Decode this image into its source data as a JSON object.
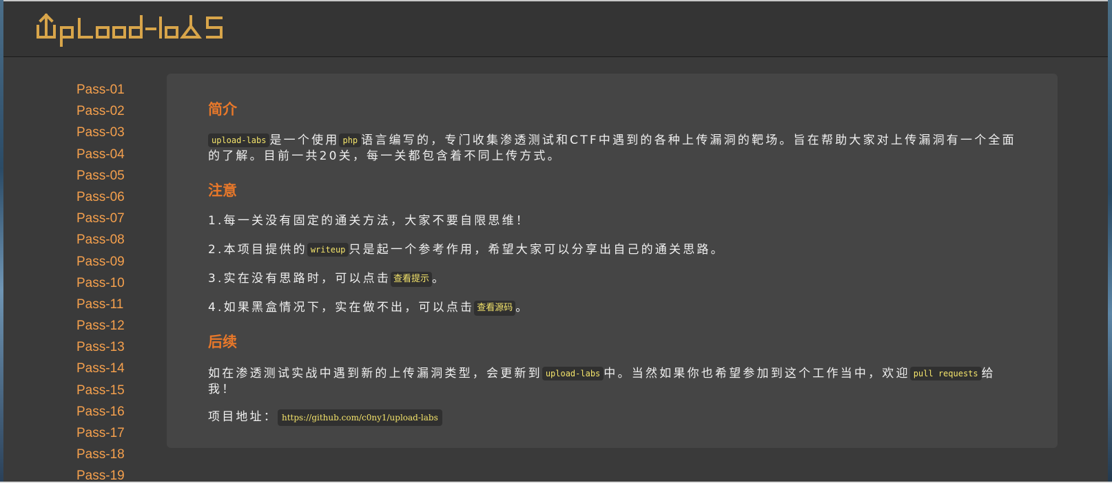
{
  "app": {
    "logo_text": "UpLoad-labs"
  },
  "sidebar": {
    "items": [
      {
        "label": "Pass-01"
      },
      {
        "label": "Pass-02"
      },
      {
        "label": "Pass-03"
      },
      {
        "label": "Pass-04"
      },
      {
        "label": "Pass-05"
      },
      {
        "label": "Pass-06"
      },
      {
        "label": "Pass-07"
      },
      {
        "label": "Pass-08"
      },
      {
        "label": "Pass-09"
      },
      {
        "label": "Pass-10"
      },
      {
        "label": "Pass-11"
      },
      {
        "label": "Pass-12"
      },
      {
        "label": "Pass-13"
      },
      {
        "label": "Pass-14"
      },
      {
        "label": "Pass-15"
      },
      {
        "label": "Pass-16"
      },
      {
        "label": "Pass-17"
      },
      {
        "label": "Pass-18"
      },
      {
        "label": "Pass-19"
      }
    ]
  },
  "intro": {
    "heading": "简介",
    "code_project": "upload-labs",
    "text_a": "是一个使用",
    "code_php": "php",
    "text_b": "语言编写的，专门收集渗透测试和CTF中遇到的各种上传漏洞的靶场。旨在帮助大家对上传漏洞有一个全面的了解。目前一共20关，每一关都包含着不同上传方式。"
  },
  "notice": {
    "heading": "注意",
    "item1": "1.每一关没有固定的通关方法，大家不要自限思维！",
    "item2_a": "2.本项目提供的",
    "item2_code": "writeup",
    "item2_b": "只是起一个参考作用，希望大家可以分享出自己的通关思路。",
    "item3_a": "3.实在没有思路时，可以点击",
    "item3_btn": "查看提示",
    "item3_b": "。",
    "item4_a": "4.如果黑盒情况下，实在做不出，可以点击",
    "item4_btn": "查看源码",
    "item4_b": "。"
  },
  "followup": {
    "heading": "后续",
    "text_a": "如在渗透测试实战中遇到新的上传漏洞类型，会更新到",
    "code_project": "upload-labs",
    "text_b": "中。当然如果你也希望参加到这个工作当中，欢迎",
    "code_pr": "pull requests",
    "text_c": "给我！",
    "address_label": "项目地址：",
    "address_url": "https://github.com/c0ny1/upload-labs"
  },
  "colors": {
    "accent_orange": "#e8782a",
    "link_orange": "#f5a04d",
    "code_yellow": "#f4e46b",
    "logo_gold": "#d8a54a"
  }
}
